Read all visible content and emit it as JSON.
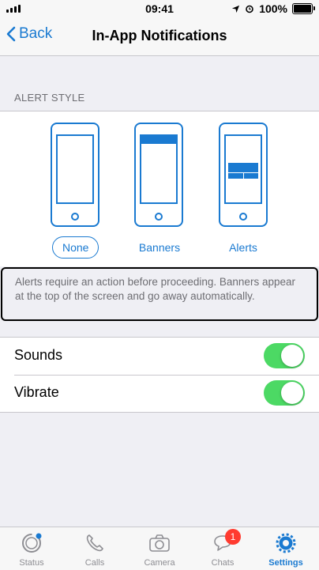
{
  "status_bar": {
    "time": "09:41",
    "battery": "100%"
  },
  "nav": {
    "back_label": "Back",
    "title": "In-App Notifications"
  },
  "alert_style": {
    "header": "ALERT STYLE",
    "options": [
      {
        "label": "None",
        "selected": true
      },
      {
        "label": "Banners",
        "selected": false
      },
      {
        "label": "Alerts",
        "selected": false
      }
    ],
    "note": "Alerts require an action before proceeding. Banners appear at the top of the screen and go away automatically."
  },
  "settings": [
    {
      "label": "Sounds",
      "on": true
    },
    {
      "label": "Vibrate",
      "on": true
    }
  ],
  "tabs": [
    {
      "label": "Status",
      "icon": "status-icon"
    },
    {
      "label": "Calls",
      "icon": "phone-icon"
    },
    {
      "label": "Camera",
      "icon": "camera-icon"
    },
    {
      "label": "Chats",
      "icon": "chat-icon",
      "badge": "1"
    },
    {
      "label": "Settings",
      "icon": "gear-icon",
      "active": true
    }
  ],
  "colors": {
    "accent": "#1a7ad1",
    "toggle_on": "#4cd964",
    "badge": "#ff3b30"
  }
}
